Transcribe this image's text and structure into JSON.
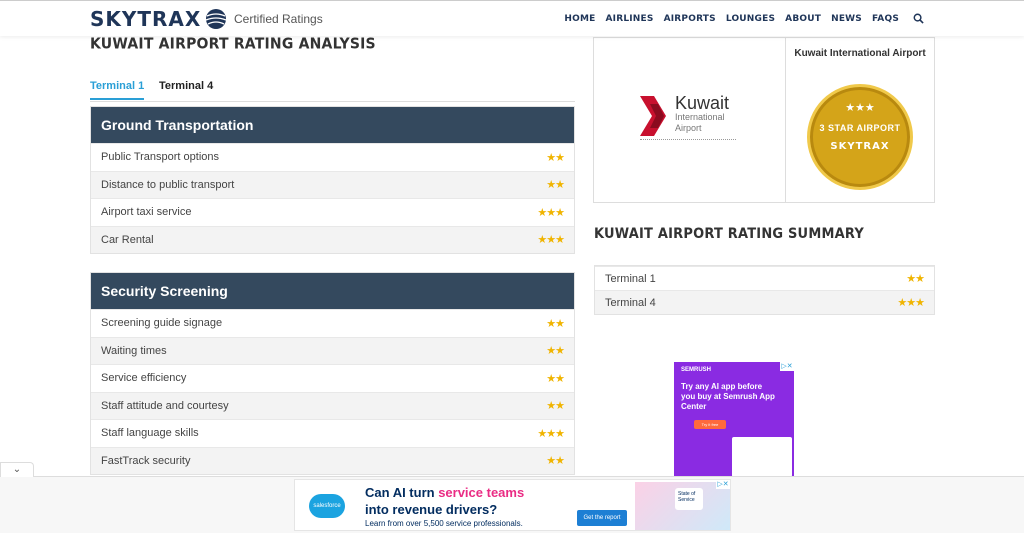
{
  "header": {
    "brand": "SKYTRAX",
    "tagline": "Certified Ratings",
    "nav": [
      "HOME",
      "AIRLINES",
      "AIRPORTS",
      "LOUNGES",
      "ABOUT",
      "NEWS",
      "FAQS"
    ]
  },
  "main": {
    "title": "KUWAIT AIRPORT RATING ANALYSIS",
    "tabs": [
      "Terminal 1",
      "Terminal 4"
    ],
    "active_tab": "Terminal 1",
    "sections": [
      {
        "heading": "Ground Transportation",
        "items": [
          {
            "label": "Public Transport options",
            "stars": 2,
            "stars_text": "★★"
          },
          {
            "label": "Distance to public transport",
            "stars": 2,
            "stars_text": "★★"
          },
          {
            "label": "Airport taxi service",
            "stars": 3,
            "stars_text": "★★★"
          },
          {
            "label": "Car Rental",
            "stars": 3,
            "stars_text": "★★★"
          }
        ]
      },
      {
        "heading": "Security Screening",
        "items": [
          {
            "label": "Screening guide signage",
            "stars": 2,
            "stars_text": "★★"
          },
          {
            "label": "Waiting times",
            "stars": 2,
            "stars_text": "★★"
          },
          {
            "label": "Service efficiency",
            "stars": 2,
            "stars_text": "★★"
          },
          {
            "label": "Staff attitude and courtesy",
            "stars": 2,
            "stars_text": "★★"
          },
          {
            "label": "Staff language skills",
            "stars": 3,
            "stars_text": "★★★"
          },
          {
            "label": "FastTrack security",
            "stars": 2,
            "stars_text": "★★"
          }
        ]
      }
    ]
  },
  "sidebar": {
    "airport_logo": {
      "name": "Kuwait",
      "sub1": "International",
      "sub2": "Airport"
    },
    "badge_title": "Kuwait International Airport",
    "badge": {
      "stars_text": "★★★",
      "label": "3 STAR AIRPORT",
      "brand": "SKYTRAX"
    },
    "summary_title": "KUWAIT AIRPORT RATING SUMMARY",
    "summary": [
      {
        "label": "Terminal 1",
        "stars": 2,
        "stars_text": "★★"
      },
      {
        "label": "Terminal 4",
        "stars": 3,
        "stars_text": "★★★"
      }
    ]
  },
  "ads": {
    "square": {
      "brand": "SEMRUSH",
      "text": "Try any AI app before you buy at Semrush App Center",
      "button": "Try it free"
    },
    "banner": {
      "brand": "salesforce",
      "line1_a": "Can AI turn ",
      "line1_b": "service teams",
      "line2": "into revenue drivers?",
      "line3": "Learn from over 5,500 service professionals.",
      "button": "Get the report",
      "card_text": "State of Service"
    }
  },
  "colors": {
    "brand_navy": "#1f3558",
    "section_header": "#34495e",
    "active_tab": "#2a9fd6",
    "star": "#f0b400",
    "badge_gold": "#d4a419"
  }
}
